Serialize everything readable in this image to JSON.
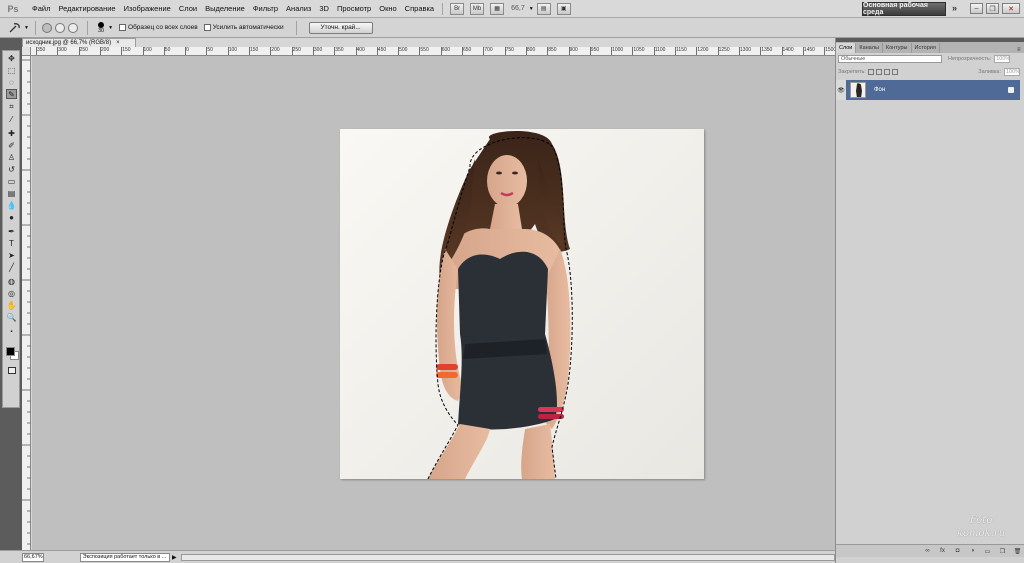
{
  "menubar": {
    "logo": "Ps",
    "items": [
      "Файл",
      "Редактирование",
      "Изображение",
      "Слои",
      "Выделение",
      "Фильтр",
      "Анализ",
      "3D",
      "Просмотр",
      "Окно",
      "Справка"
    ],
    "zoom": "66,7",
    "workspace": "Основная рабочая среда"
  },
  "options": {
    "brush_size": "30",
    "sample_all_layers": "Образец со всех слоев",
    "auto_enhance": "Усилить автоматически",
    "refine_edge": "Уточн. край..."
  },
  "document": {
    "tab_title": "исходник.jpg @ 66,7% (RGB/8)",
    "ruler_labels": [
      "350",
      "300",
      "250",
      "200",
      "150",
      "100",
      "50",
      "0",
      "50",
      "100",
      "150",
      "200",
      "250",
      "300",
      "350",
      "400",
      "450",
      "500",
      "550",
      "600",
      "650",
      "700",
      "750",
      "800",
      "850",
      "900",
      "950",
      "1000",
      "1050",
      "1100",
      "1150",
      "1200",
      "1250",
      "1300",
      "1350",
      "1400",
      "1450",
      "1500"
    ]
  },
  "status": {
    "zoom": "66,67%",
    "text": "Экспозиция работает только в ..."
  },
  "layers_panel": {
    "tabs": [
      "Слои",
      "Каналы",
      "Контуры",
      "История"
    ],
    "blend_mode": "Обычные",
    "opacity_label": "Непрозрачность:",
    "opacity": "100%",
    "lock_label": "Закрепить:",
    "fill_label": "Заливка:",
    "fill": "100%",
    "layer_name": "Фон"
  },
  "watermark": {
    "line1": "Foto",
    "line2": "komok.ru"
  },
  "colors": {
    "layer_selected": "#4f6a97",
    "workspace_button": "#4a4a4a",
    "canvas_bg": "#bfbfbf"
  }
}
